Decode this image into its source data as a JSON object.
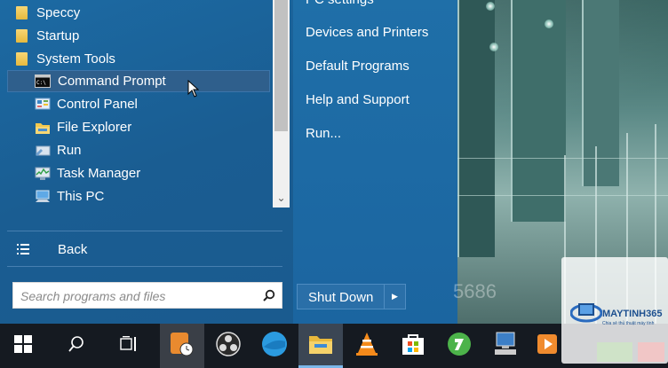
{
  "start_menu": {
    "programs": [
      {
        "label": "Speccy",
        "icon": "folder-icon",
        "selected": false
      },
      {
        "label": "Startup",
        "icon": "folder-icon",
        "selected": false
      },
      {
        "label": "System Tools",
        "icon": "folder-icon",
        "selected": false
      },
      {
        "label": "Command Prompt",
        "icon": "cmd-icon",
        "selected": true
      },
      {
        "label": "Control Panel",
        "icon": "control-panel-icon",
        "selected": false
      },
      {
        "label": "File Explorer",
        "icon": "file-explorer-icon",
        "selected": false
      },
      {
        "label": "Run",
        "icon": "run-icon",
        "selected": false
      },
      {
        "label": "Task Manager",
        "icon": "task-manager-icon",
        "selected": false
      },
      {
        "label": "This PC",
        "icon": "this-pc-icon",
        "selected": false
      }
    ],
    "back_label": "Back",
    "search": {
      "placeholder": "Search programs and files"
    },
    "right_items": [
      {
        "label": "PC settings"
      },
      {
        "label": "Devices and Printers"
      },
      {
        "label": "Default Programs"
      },
      {
        "label": "Help and Support"
      },
      {
        "label": "Run..."
      }
    ],
    "shutdown_label": "Shut Down",
    "faint_text": "5686"
  },
  "taskbar": {
    "buttons": [
      {
        "name": "start-button",
        "icon": "windows-logo-icon"
      },
      {
        "name": "search-button",
        "icon": "search-icon"
      },
      {
        "name": "task-view-button",
        "icon": "task-view-icon"
      },
      {
        "name": "taskbar-clock-app",
        "icon": "clock-app-icon"
      },
      {
        "name": "taskbar-obs",
        "icon": "obs-icon"
      },
      {
        "name": "taskbar-browser",
        "icon": "blue-globe-icon"
      },
      {
        "name": "taskbar-file-explorer",
        "icon": "folder-icon",
        "active": true
      },
      {
        "name": "taskbar-vlc",
        "icon": "vlc-icon"
      },
      {
        "name": "taskbar-store",
        "icon": "store-icon"
      },
      {
        "name": "taskbar-green-app",
        "icon": "green-app-icon"
      },
      {
        "name": "taskbar-network",
        "icon": "computer-icon"
      },
      {
        "name": "taskbar-media",
        "icon": "media-icon"
      }
    ]
  },
  "watermark": {
    "brand": "MAYTINH365",
    "tagline": "Chia sẻ thủ thuật máy tính"
  },
  "colors": {
    "menu_blue": "#1a5d92",
    "taskbar": "#151a21",
    "selection": "#2f5f8c"
  }
}
